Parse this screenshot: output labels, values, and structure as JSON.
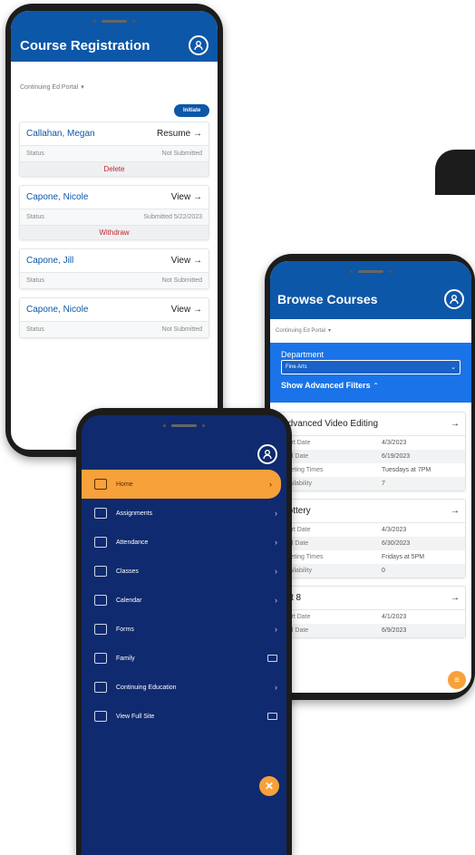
{
  "registration": {
    "title": "Course Registration",
    "portal": "Continuing Ed Portal",
    "initiate_label": "Initiate",
    "cards": [
      {
        "name": "Callahan, Megan",
        "action": "Resume",
        "status_label": "Status",
        "status_value": "Not Submitted",
        "extra": "Delete"
      },
      {
        "name": "Capone, Nicole",
        "action": "View",
        "status_label": "Status",
        "status_value": "Submitted 5/22/2023",
        "extra": "Withdraw"
      },
      {
        "name": "Capone, Jill",
        "action": "View",
        "status_label": "Status",
        "status_value": "Not Submitted",
        "extra": ""
      },
      {
        "name": "Capone, Nicole",
        "action": "View",
        "status_label": "Status",
        "status_value": "Not Submitted",
        "extra": ""
      }
    ]
  },
  "menu": {
    "items": [
      {
        "label": "Home",
        "icon": "home-icon",
        "trail": "chevron"
      },
      {
        "label": "Assignments",
        "icon": "assignments-icon",
        "trail": "chevron"
      },
      {
        "label": "Attendance",
        "icon": "attendance-icon",
        "trail": "chevron"
      },
      {
        "label": "Classes",
        "icon": "classes-icon",
        "trail": "chevron"
      },
      {
        "label": "Calendar",
        "icon": "calendar-icon",
        "trail": "chevron"
      },
      {
        "label": "Forms",
        "icon": "forms-icon",
        "trail": "chevron"
      },
      {
        "label": "Family",
        "icon": "family-icon",
        "trail": "external"
      },
      {
        "label": "Continuing Education",
        "icon": "continuing-education-icon",
        "trail": "chevron"
      },
      {
        "label": "View Full Site",
        "icon": "view-full-site-icon",
        "trail": "external"
      }
    ],
    "colors": {
      "background": "#0f2a6e",
      "active": "#f7a13a"
    }
  },
  "browse": {
    "title": "Browse Courses",
    "portal": "Continuing Ed Portal",
    "department_label": "Department",
    "department_value": "Fine Arts",
    "advanced_label": "Show Advanced Filters",
    "courses": [
      {
        "title": "Advanced Video Editing",
        "rows": [
          {
            "k": "Start Date",
            "v": "4/3/2023"
          },
          {
            "k": "End Date",
            "v": "6/19/2023"
          },
          {
            "k": "Meeting Times",
            "v": "Tuesdays at 7PM"
          },
          {
            "k": "Availability",
            "v": "7"
          }
        ]
      },
      {
        "title": "Pottery",
        "rows": [
          {
            "k": "Start Date",
            "v": "4/3/2023"
          },
          {
            "k": "End Date",
            "v": "6/30/2023"
          },
          {
            "k": "Meeting Times",
            "v": "Fridays at 5PM"
          },
          {
            "k": "Availability",
            "v": "0"
          }
        ]
      },
      {
        "title": "Art 8",
        "rows": [
          {
            "k": "Start Date",
            "v": "4/1/2023"
          },
          {
            "k": "End Date",
            "v": "6/9/2023"
          }
        ]
      }
    ]
  },
  "accent": "#0d57a8"
}
